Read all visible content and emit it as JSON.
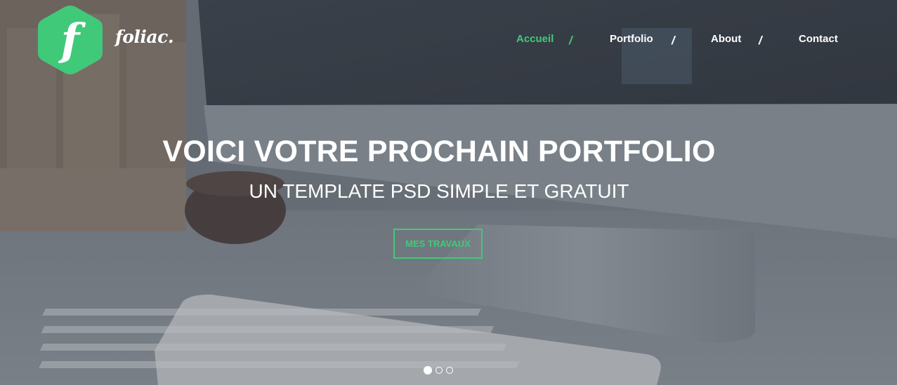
{
  "brand": {
    "logo_letter": "f",
    "name": "foliac.",
    "logo_color": "#41c97a"
  },
  "nav": {
    "items": [
      {
        "label": "Accueil",
        "active": true
      },
      {
        "label": "Portfolio",
        "active": false
      },
      {
        "label": "About",
        "active": false
      },
      {
        "label": "Contact",
        "active": false
      }
    ],
    "separator": "/",
    "active_color": "#41c97a"
  },
  "hero": {
    "title": "VOICI VOTRE PROCHAIN PORTFOLIO",
    "subtitle": "UN TEMPLATE PSD SIMPLE ET GRATUIT",
    "cta_label": "MES TRAVAUX",
    "background": "desk-with-monitor-and-keyboard-photo"
  },
  "slider": {
    "count": 3,
    "active_index": 0
  }
}
